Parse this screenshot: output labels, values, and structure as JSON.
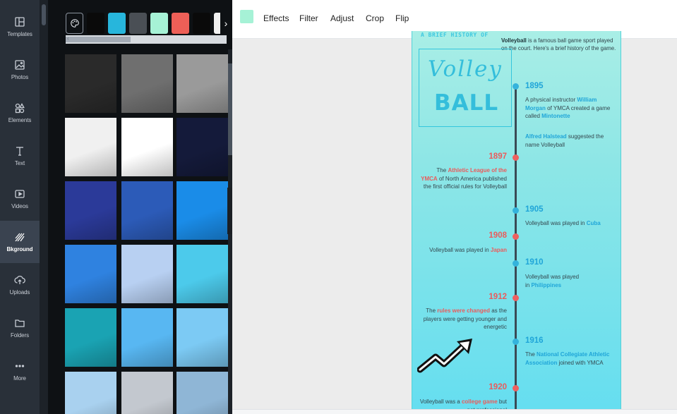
{
  "sidebar": {
    "items": [
      {
        "label": "Templates",
        "icon": "templates-icon"
      },
      {
        "label": "Photos",
        "icon": "photos-icon"
      },
      {
        "label": "Elements",
        "icon": "elements-icon"
      },
      {
        "label": "Text",
        "icon": "text-icon"
      },
      {
        "label": "Videos",
        "icon": "videos-icon"
      },
      {
        "label": "Bkground",
        "icon": "background-icon",
        "active": true
      },
      {
        "label": "Uploads",
        "icon": "uploads-icon"
      },
      {
        "label": "Folders",
        "icon": "folders-icon"
      },
      {
        "label": "More",
        "icon": "more-icon"
      }
    ]
  },
  "panel": {
    "swatches": [
      "#0a0a0a",
      "#27b6dc",
      "#4a4f55",
      "#a6f2d6",
      "#ed5f57",
      "#0a0a0a",
      "#f1f1f1"
    ],
    "tile_colors": [
      [
        "#2a2a2a",
        "#6f6f6f",
        "#9a9a9a"
      ],
      [
        "#f0f0f0",
        "#ffffff",
        "#141a3a"
      ],
      [
        "#2b3a99",
        "#2c5bb8",
        "#1a8ce8"
      ],
      [
        "#2f82e0",
        "#b8d0f2",
        "#4ccaeb"
      ],
      [
        "#1aa3b3",
        "#58b7f2",
        "#7ccaf4"
      ],
      [
        "#a9d1ef",
        "#c3c8cf",
        "#8fb6d6"
      ]
    ]
  },
  "toolbar": {
    "color": "#a6f2d6",
    "effects": "Effects",
    "filter": "Filter",
    "adjust": "Adjust",
    "crop": "Crop",
    "flip": "Flip"
  },
  "design": {
    "kicker": "A BRIEF HISTORY OF",
    "intro_bold": "Volleyball",
    "intro_rest": " is a famous ball game sport played on the court. Here's a brief history of the game.",
    "title_1": "Volley",
    "title_2": "BALL",
    "events": {
      "y1895": "1895",
      "e1895_a": "A physical instructor ",
      "e1895_name": "William Morgan",
      "e1895_b": " of YMCA created a game called ",
      "e1895_game": "Mintonette",
      "e1895_c_name": "Alfred Halstead",
      "e1895_c": " suggested the name Volleyball",
      "y1897": "1897",
      "e1897_a": "The ",
      "e1897_hl": "Athletic League of the YMCA",
      "e1897_b": " of North America published the first official rules for Volleyball",
      "y1905": "1905",
      "e1905_a": "Volleyball was played in ",
      "e1905_hl": "Cuba",
      "y1908": "1908",
      "e1908_a": "Volleyball was played in ",
      "e1908_hl": "Japan",
      "y1910": "1910",
      "e1910_a": "Volleyball was played in ",
      "e1910_hl": "Philippines",
      "y1912": "1912",
      "e1912_a": "The ",
      "e1912_hl": "rules were changed",
      "e1912_b": " as the players were getting younger and energetic",
      "y1916": "1916",
      "e1916_a": "The ",
      "e1916_hl": "National Collegiate Athletic Association",
      "e1916_b": " joined with YMCA",
      "y1920": "1920",
      "e1920_a": "Volleyball was a ",
      "e1920_hl": "college game",
      "e1920_b": " but not professional"
    }
  }
}
